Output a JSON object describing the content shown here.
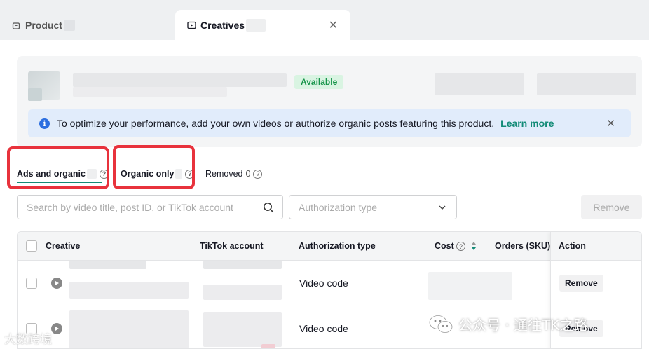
{
  "tabs": {
    "product_label": "Product",
    "creatives_label": "Creatives"
  },
  "header": {
    "status_badge": "Available"
  },
  "notice": {
    "text": "To optimize your performance, add your own videos or authorize organic posts featuring this product.",
    "link": "Learn more"
  },
  "subtabs": {
    "ads_label": "Ads and organic",
    "organic_label": "Organic only",
    "removed_label": "Removed",
    "removed_count": "0"
  },
  "filters": {
    "search_placeholder": "Search by video title, post ID, or TikTok account",
    "auth_placeholder": "Authorization type",
    "remove_label": "Remove"
  },
  "table": {
    "columns": [
      "Creative",
      "TikTok account",
      "Authorization type",
      "Cost",
      "Orders (SKU)",
      "Action"
    ],
    "rows": [
      {
        "authorization_type": "Video code",
        "action": "Remove"
      },
      {
        "authorization_type": "Video code",
        "action": "Remove"
      }
    ]
  },
  "watermarks": {
    "right": "公众号 · 通往TK之路",
    "left": "大数跨境"
  },
  "colors": {
    "accent": "#138b77",
    "highlight": "#e8323c",
    "info": "#2d6fe0"
  }
}
